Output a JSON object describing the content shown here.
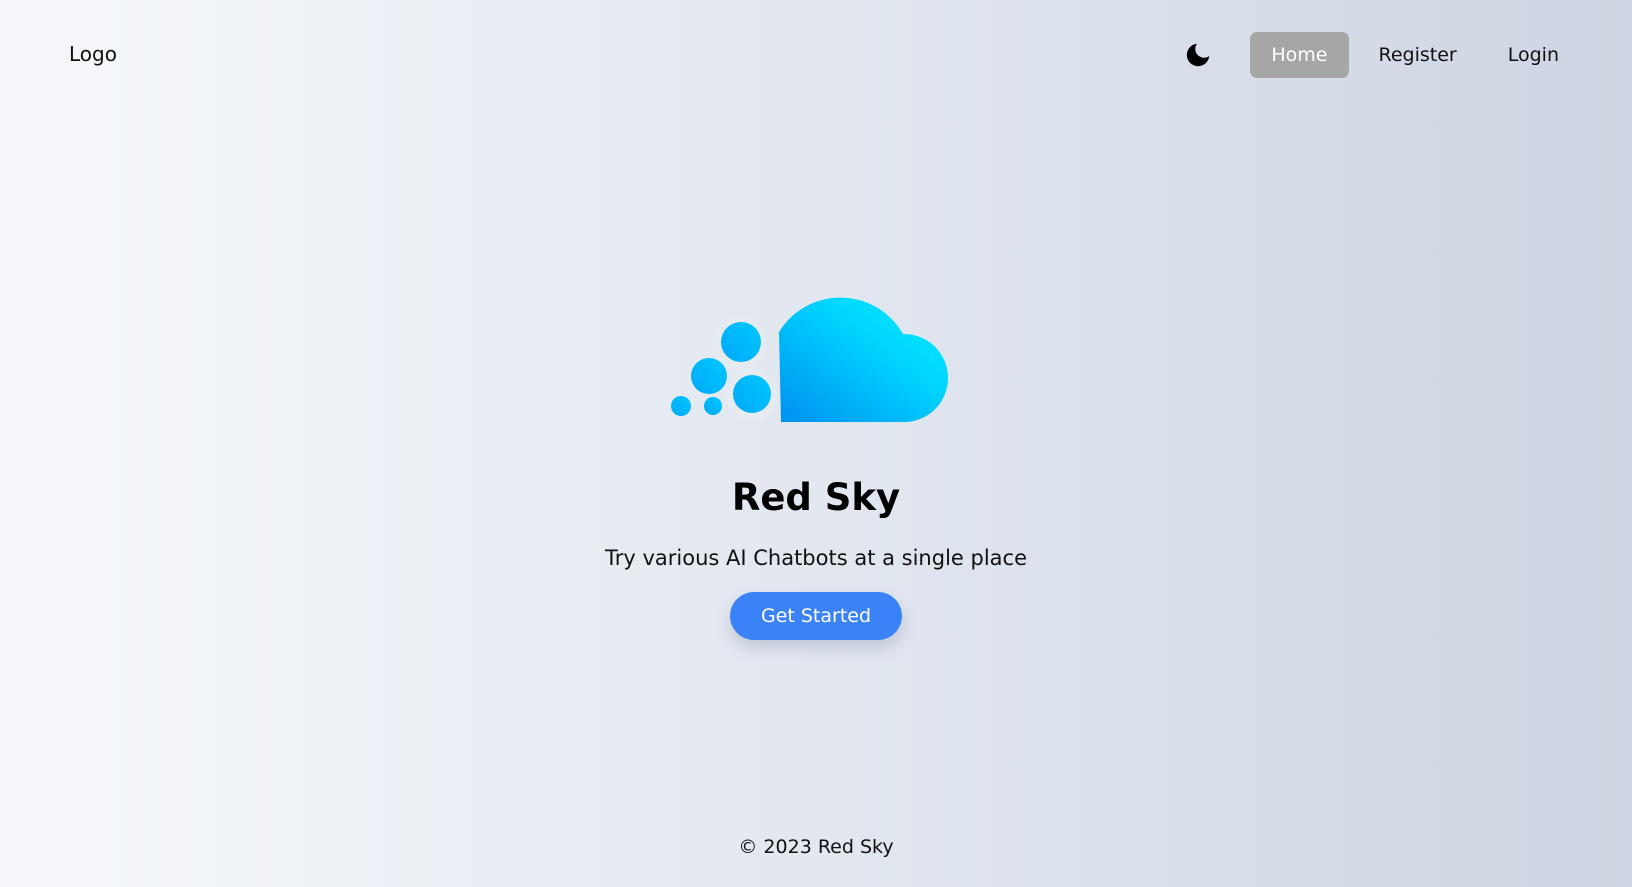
{
  "nav": {
    "logo_text": "Logo",
    "links": [
      {
        "label": "Home",
        "active": true
      },
      {
        "label": "Register",
        "active": false
      },
      {
        "label": "Login",
        "active": false
      }
    ],
    "theme_toggle_icon": "moon-icon"
  },
  "hero": {
    "logo_icon": "cloud-icon",
    "title": "Red Sky",
    "subtitle": "Try various AI Chatbots at a single place",
    "cta_label": "Get Started"
  },
  "footer": {
    "copyright": "© 2023 Red Sky"
  },
  "colors": {
    "accent": "#3b82f6",
    "active_nav_bg": "#a6a6a6",
    "cloud_light": "#00e5ff",
    "cloud_dark": "#00a8f0"
  }
}
